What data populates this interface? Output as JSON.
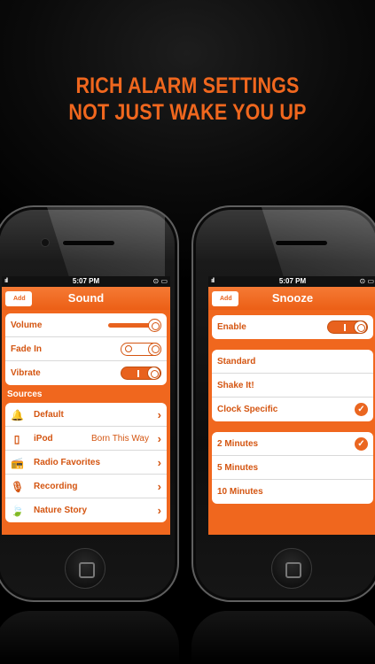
{
  "headline": {
    "line1": "RICH ALARM SETTINGS",
    "line2": "NOT JUST WAKE YOU UP"
  },
  "colors": {
    "accent": "#f0671e",
    "background": "#000000"
  },
  "left_screen": {
    "status": {
      "signal": "ııll",
      "time": "5:07 PM",
      "right": "⊙ ▭"
    },
    "nav": {
      "add_label": "Add",
      "title": "Sound"
    },
    "settings": [
      {
        "label": "Volume",
        "control": "slider",
        "level": 1.0
      },
      {
        "label": "Fade In",
        "control": "toggle-off"
      },
      {
        "label": "Vibrate",
        "control": "toggle-on"
      }
    ],
    "sources_header": "Sources",
    "sources": [
      {
        "icon": "bell-icon",
        "glyph": "🔔",
        "label": "Default",
        "value": ""
      },
      {
        "icon": "ipod-icon",
        "glyph": "▯",
        "label": "iPod",
        "value": "Born This Way"
      },
      {
        "icon": "radio-icon",
        "glyph": "📻",
        "label": "Radio Favorites",
        "value": ""
      },
      {
        "icon": "microphone-icon",
        "glyph": "🎙",
        "label": "Recording",
        "value": ""
      },
      {
        "icon": "leaf-icon",
        "glyph": "🍃",
        "label": "Nature Story",
        "value": ""
      }
    ]
  },
  "right_screen": {
    "status": {
      "signal": "ııll",
      "time": "5:07 PM",
      "right": "⊙ ▭"
    },
    "nav": {
      "add_label": "Add",
      "title": "Snooze"
    },
    "enable": {
      "label": "Enable",
      "control": "toggle-on"
    },
    "modes": [
      {
        "label": "Standard",
        "checked": false
      },
      {
        "label": "Shake It!",
        "checked": false
      },
      {
        "label": "Clock Specific",
        "checked": true
      }
    ],
    "durations": [
      {
        "label": "2 Minutes",
        "checked": true
      },
      {
        "label": "5 Minutes",
        "checked": false
      },
      {
        "label": "10 Minutes",
        "checked": false
      }
    ],
    "check_glyph": "✓",
    "chevron_glyph": "›"
  }
}
